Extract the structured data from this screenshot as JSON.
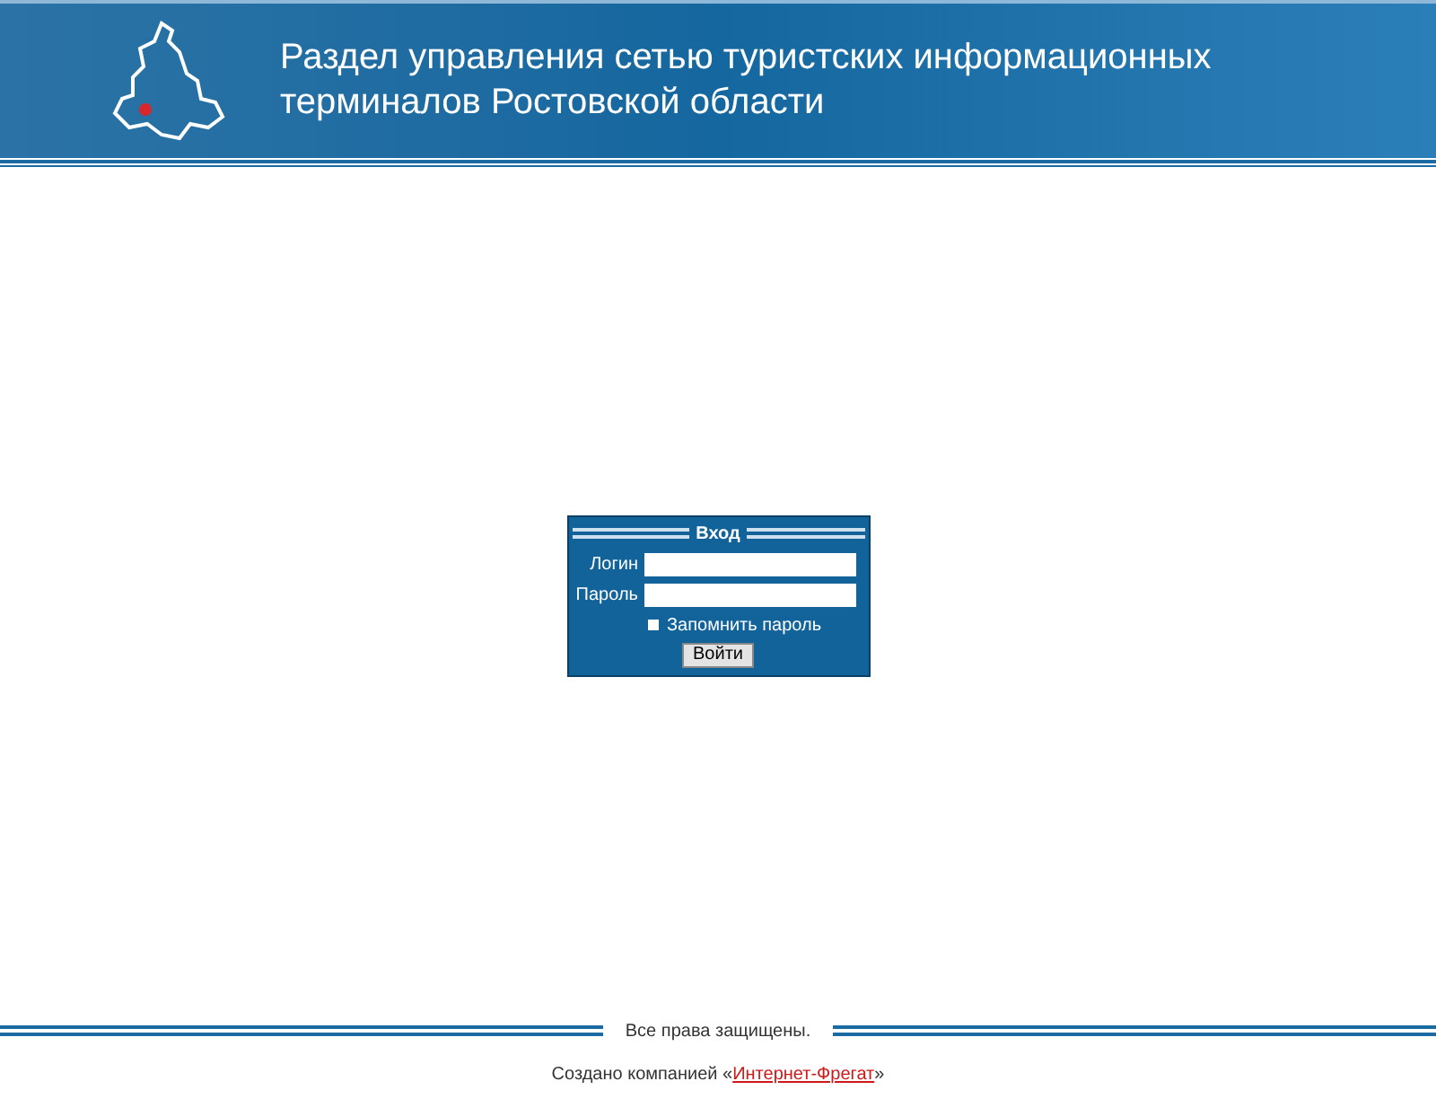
{
  "header": {
    "title": "Раздел управления сетью туристских информационных терминалов Ростовской области"
  },
  "login": {
    "title": "Вход",
    "fields": [
      {
        "label": "Логин"
      },
      {
        "label": "Пароль"
      }
    ],
    "remember": {
      "label": "Запомнить пароль",
      "checked": false
    },
    "submit": "Войти"
  },
  "footer": {
    "rights": "Все права защищены.",
    "credit_prefix": "Создано компанией «",
    "credit_link": "Интернет-Фрегат",
    "credit_suffix": "»"
  }
}
